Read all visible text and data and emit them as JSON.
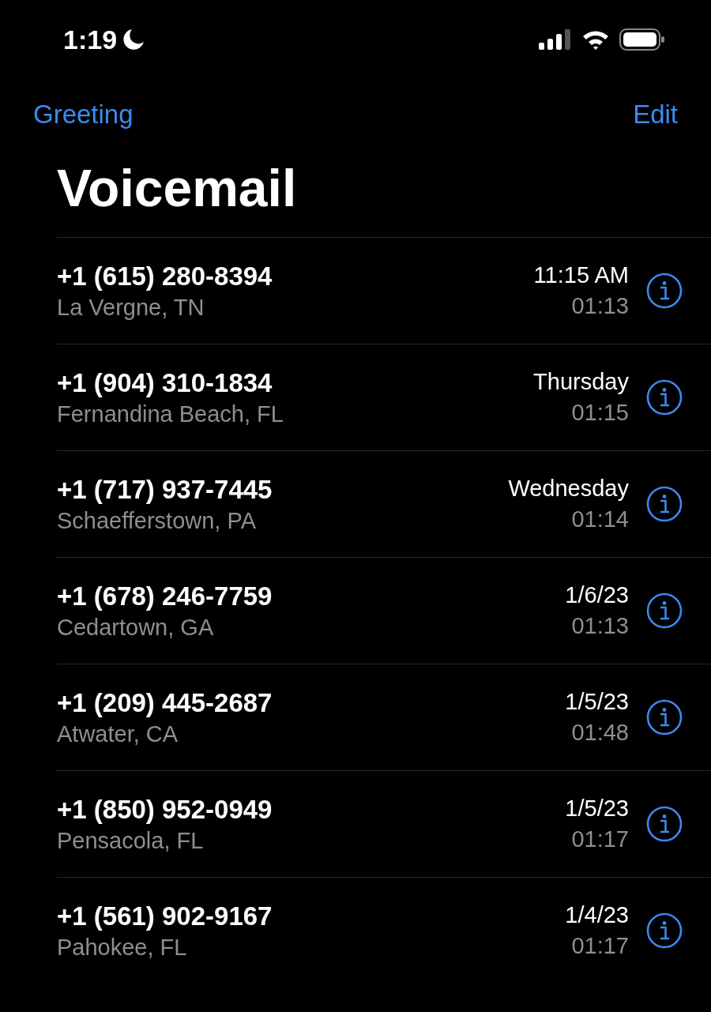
{
  "status_bar": {
    "time": "1:19",
    "focus_moon": true
  },
  "nav": {
    "left": "Greeting",
    "right": "Edit"
  },
  "title": "Voicemail",
  "voicemails": [
    {
      "number": "+1 (615) 280-8394",
      "location": "La Vergne, TN",
      "when": "11:15 AM",
      "duration": "01:13"
    },
    {
      "number": "+1 (904) 310-1834",
      "location": "Fernandina Beach, FL",
      "when": "Thursday",
      "duration": "01:15"
    },
    {
      "number": "+1 (717) 937-7445",
      "location": "Schaefferstown, PA",
      "when": "Wednesday",
      "duration": "01:14"
    },
    {
      "number": "+1 (678) 246-7759",
      "location": "Cedartown, GA",
      "when": "1/6/23",
      "duration": "01:13"
    },
    {
      "number": "+1 (209) 445-2687",
      "location": "Atwater, CA",
      "when": "1/5/23",
      "duration": "01:48"
    },
    {
      "number": "+1 (850) 952-0949",
      "location": "Pensacola, FL",
      "when": "1/5/23",
      "duration": "01:17"
    },
    {
      "number": "+1 (561) 902-9167",
      "location": "Pahokee, FL",
      "when": "1/4/23",
      "duration": "01:17"
    }
  ]
}
